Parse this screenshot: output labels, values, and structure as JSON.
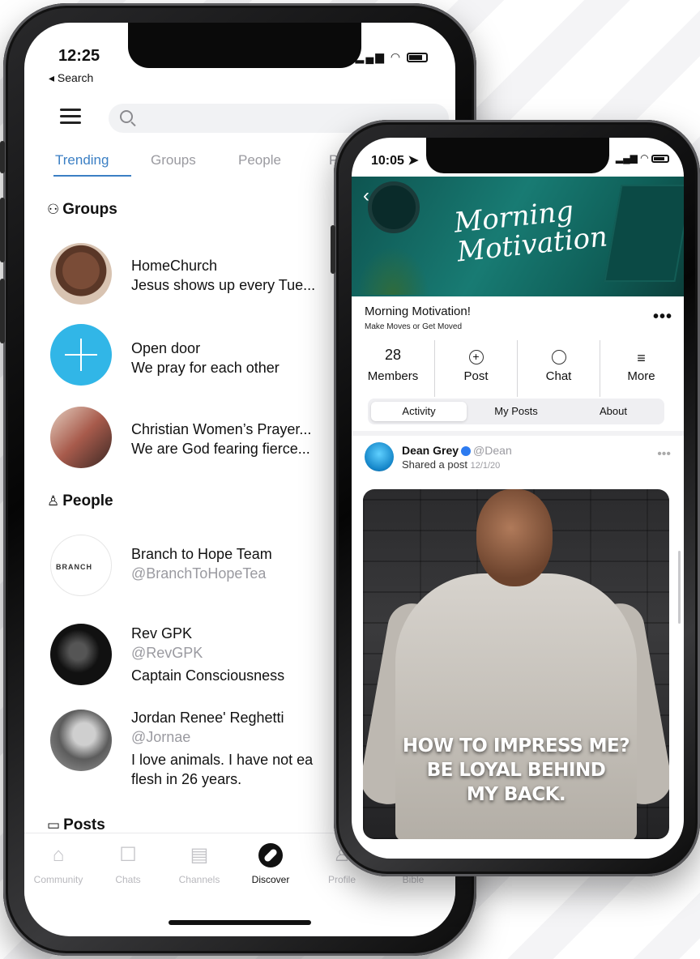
{
  "left_phone": {
    "status": {
      "time": "12:25",
      "back_label": "◂ Search"
    },
    "tabs": [
      "Trending",
      "Groups",
      "People",
      "P"
    ],
    "groups_heading": "Groups",
    "groups": [
      {
        "name": "HomeChurch",
        "desc": "Jesus shows up every Tue..."
      },
      {
        "name": "Open door",
        "desc": "We pray for each other"
      },
      {
        "name": "Christian Women’s Prayer...",
        "desc": "We are God fearing fierce..."
      }
    ],
    "people_heading": "People",
    "people": [
      {
        "name": "Branch to Hope Team",
        "handle": "@BranchToHopeTea",
        "bio": "",
        "logo_text": "BRANCH"
      },
      {
        "name": "Rev GPK",
        "handle": "@RevGPK",
        "bio": "Captain Consciousness"
      },
      {
        "name": "Jordan Renee' Reghetti",
        "handle": "@Jornae",
        "bio": "I love animals. I have not ea",
        "bio2": "flesh in 26 years."
      }
    ],
    "posts_heading": "Posts",
    "nav": [
      "Community",
      "Chats",
      "Channels",
      "Discover",
      "Profile",
      "Bible"
    ]
  },
  "right_phone": {
    "status": {
      "time": "10:05"
    },
    "banner_title_line1": "Morning",
    "banner_title_line2": "Motivation",
    "group_title": "Morning Motivation!",
    "group_subtitle": "Make Moves or Get Moved",
    "stats": [
      {
        "value": "28",
        "label": "Members"
      },
      {
        "icon": "plus-circle-icon",
        "label": "Post"
      },
      {
        "icon": "chat-bubble-icon",
        "label": "Chat"
      },
      {
        "icon": "filter-lines-icon",
        "label": "More"
      }
    ],
    "segments": [
      "Activity",
      "My Posts",
      "About"
    ],
    "post": {
      "author": "Dean Grey",
      "handle": "@Dean",
      "action": "Shared a post",
      "date": "12/1/20",
      "quote_line1": "HOW TO IMPRESS ME?",
      "quote_line2": "BE LOYAL BEHIND",
      "quote_line3": "MY BACK."
    }
  },
  "colors": {
    "accent": "#3b7fc4",
    "open_door": "#31b6e7",
    "banner": "#187b73"
  }
}
